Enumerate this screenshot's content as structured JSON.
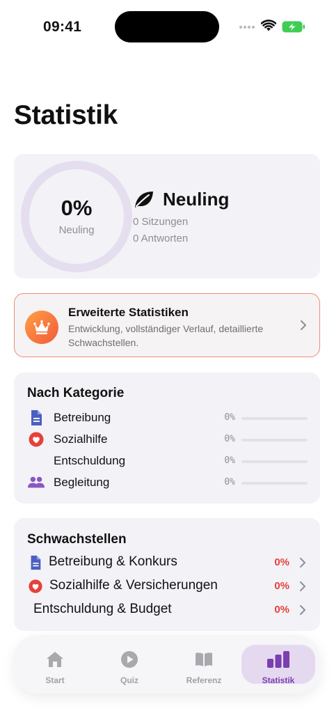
{
  "status_bar": {
    "time": "09:41"
  },
  "page": {
    "title": "Statistik"
  },
  "level_card": {
    "progress_percent": 0,
    "ring_value": "0%",
    "ring_label": "Neuling",
    "level_name": "Neuling",
    "sessions": "0 Sitzungen",
    "answers": "0 Antworten",
    "icon": "leaf-icon"
  },
  "premium_card": {
    "title": "Erweiterte Statistiken",
    "description": "Entwicklung, vollständiger Verlauf, detaillierte Schwachstellen.",
    "icon": "crown-icon"
  },
  "category_section": {
    "title": "Nach Kategorie",
    "rows": [
      {
        "label": "Betreibung",
        "percent_text": "0%",
        "progress": 0,
        "icon": "document-icon",
        "icon_color": "#4a5fc1"
      },
      {
        "label": "Sozialhilfe",
        "percent_text": "0%",
        "progress": 0,
        "icon": "heart-icon",
        "icon_color": "#e5413a"
      },
      {
        "label": "Entschuldung",
        "percent_text": "0%",
        "progress": 0,
        "icon": "",
        "icon_color": ""
      },
      {
        "label": "Begleitung",
        "percent_text": "0%",
        "progress": 0,
        "icon": "people-icon",
        "icon_color": "#8a56c2"
      }
    ]
  },
  "weak_section": {
    "title": "Schwachstellen",
    "rows": [
      {
        "label": "Betreibung & Konkurs",
        "percent_text": "0%",
        "icon": "document-icon"
      },
      {
        "label": "Sozialhilfe & Versicherungen",
        "percent_text": "0%",
        "icon": "heart-icon"
      },
      {
        "label": "Entschuldung & Budget",
        "percent_text": "0%",
        "icon": ""
      }
    ]
  },
  "tab_bar": {
    "active": "Statistik",
    "tabs": [
      {
        "label": "Start",
        "icon": "home-icon"
      },
      {
        "label": "Quiz",
        "icon": "play-icon"
      },
      {
        "label": "Referenz",
        "icon": "book-icon"
      },
      {
        "label": "Statistik",
        "icon": "bar-chart-icon"
      }
    ]
  },
  "colors": {
    "accent": "#7b3fb0",
    "danger": "#e5413a",
    "card_background": "#f3f2f7",
    "ring_track": "#e4deee"
  }
}
